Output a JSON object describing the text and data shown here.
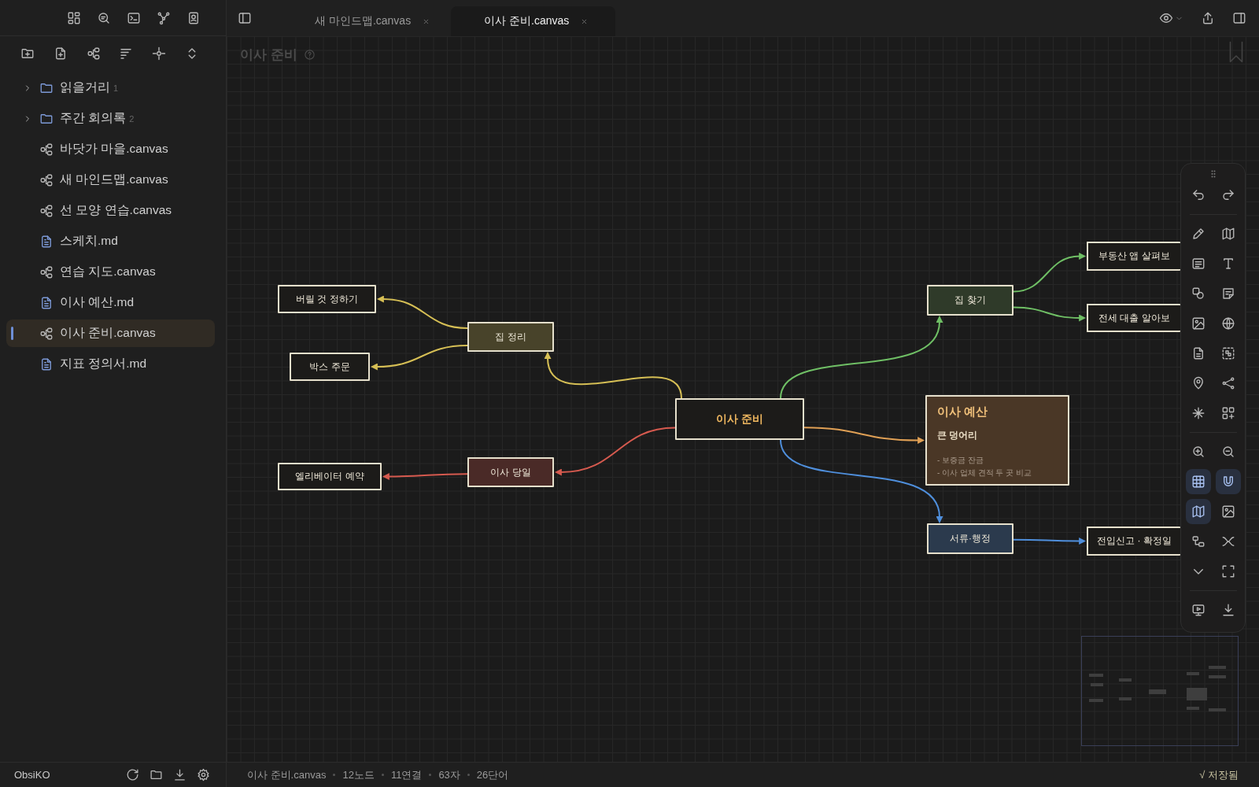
{
  "sidebar": {
    "tree": [
      {
        "kind": "folder",
        "name": "읽을거리",
        "count": "1",
        "expanded": false,
        "selected": false
      },
      {
        "kind": "folder",
        "name": "주간 회의록",
        "count": "2",
        "expanded": false,
        "selected": false
      },
      {
        "kind": "canvas",
        "name": "바닷가 마을.canvas",
        "selected": false
      },
      {
        "kind": "canvas",
        "name": "새 마인드맵.canvas",
        "selected": false
      },
      {
        "kind": "canvas",
        "name": "선 모양 연습.canvas",
        "selected": false
      },
      {
        "kind": "md",
        "name": "스케치.md",
        "selected": false
      },
      {
        "kind": "canvas",
        "name": "연습 지도.canvas",
        "selected": false
      },
      {
        "kind": "md",
        "name": "이사 예산.md",
        "selected": false
      },
      {
        "kind": "canvas",
        "name": "이사 준비.canvas",
        "selected": true
      },
      {
        "kind": "md",
        "name": "지표 정의서.md",
        "selected": false
      }
    ]
  },
  "tabs": [
    {
      "label": "새 마인드맵.canvas",
      "selected": false
    },
    {
      "label": "이사 준비.canvas",
      "selected": true
    }
  ],
  "canvas": {
    "title": "이사 준비",
    "nodes": [
      {
        "kind": "text",
        "text": "버릴 것 정하기"
      },
      {
        "kind": "text",
        "text": "박스 주문"
      },
      {
        "kind": "text",
        "text": "집 정리",
        "color": "#48432a"
      },
      {
        "kind": "text",
        "text": "엘리베이터 예약"
      },
      {
        "kind": "text",
        "text": "이사 당일",
        "color": "#4a2a27"
      },
      {
        "kind": "root",
        "text": "이사 준비"
      },
      {
        "kind": "text",
        "text": "집 찾기",
        "color": "#2f3a29"
      },
      {
        "kind": "text",
        "text": "부동산 앱 살펴보"
      },
      {
        "kind": "text",
        "text": "전세 대출 알아보"
      },
      {
        "kind": "card",
        "title": "이사 예산",
        "heading": "큰 덩어리",
        "lines": [
          "- 보증금 잔금",
          "- 이사 업체 견적 두 곳 비교"
        ],
        "color": "#4a3726"
      },
      {
        "kind": "text",
        "text": "서류·행정",
        "color": "#2b3a4d"
      },
      {
        "kind": "text",
        "text": "전입신고 · 확정일"
      }
    ],
    "edges": [
      {
        "color": "#d6bf55"
      },
      {
        "color": "#d6bf55"
      },
      {
        "color": "#d6bf55"
      },
      {
        "color": "#d65a4f"
      },
      {
        "color": "#d65a4f"
      },
      {
        "color": "#6fbf65"
      },
      {
        "color": "#6fbf65"
      },
      {
        "color": "#6fbf65"
      },
      {
        "color": "#e0a055"
      },
      {
        "color": "#4f8fdc"
      },
      {
        "color": "#4f8fdc"
      }
    ]
  },
  "toolbar": {
    "toggles": [
      {
        "on": true
      },
      {
        "on": true
      },
      {
        "on": true
      },
      {
        "on": false
      }
    ]
  },
  "status_bar": {
    "vault": "ObsiKO",
    "stats": [
      "이사 준비.canvas",
      "12노드",
      "11연결",
      "63자",
      "26단어"
    ],
    "saved": "√ 저장됨"
  }
}
